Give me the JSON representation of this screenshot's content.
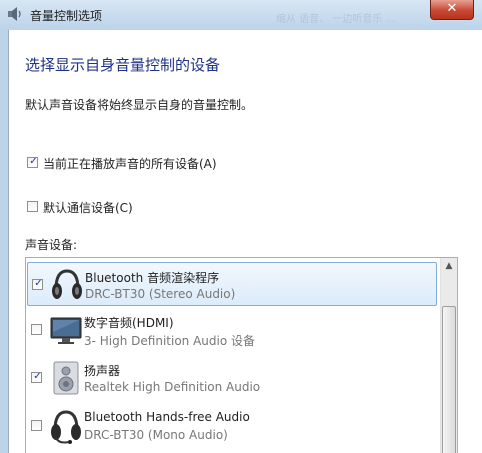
{
  "window": {
    "title": "音量控制选项",
    "background_text": "缩从 语音、 一边听音乐 ...",
    "close_label": "✕"
  },
  "dialog": {
    "heading": "选择显示自身音量控制的设备",
    "description": "默认声音设备将始终显示自身的音量控制。",
    "options": [
      {
        "label": "当前正在播放声音的所有设备(A)",
        "checked": true
      },
      {
        "label": "默认通信设备(C)",
        "checked": false
      }
    ],
    "devices_label": "声音设备:",
    "devices": [
      {
        "name": "Bluetooth 音频渲染程序",
        "detail": "DRC-BT30 (Stereo Audio)",
        "checked": true,
        "icon": "headset-icon",
        "selected": true
      },
      {
        "name": "数字音频(HDMI)",
        "detail": "3- High Definition Audio 设备",
        "checked": false,
        "icon": "monitor-icon",
        "selected": false
      },
      {
        "name": "扬声器",
        "detail": "Realtek High Definition Audio",
        "checked": true,
        "icon": "speaker-icon",
        "selected": false
      },
      {
        "name": "Bluetooth Hands-free Audio",
        "detail": "DRC-BT30 (Mono Audio)",
        "checked": false,
        "icon": "headset-icon",
        "selected": false
      }
    ],
    "check_glyph": "✓",
    "scroll_up_glyph": "▲"
  },
  "colors": {
    "heading": "#1e3287",
    "close_button": "#c74a35",
    "selection": "#dcebfb"
  }
}
